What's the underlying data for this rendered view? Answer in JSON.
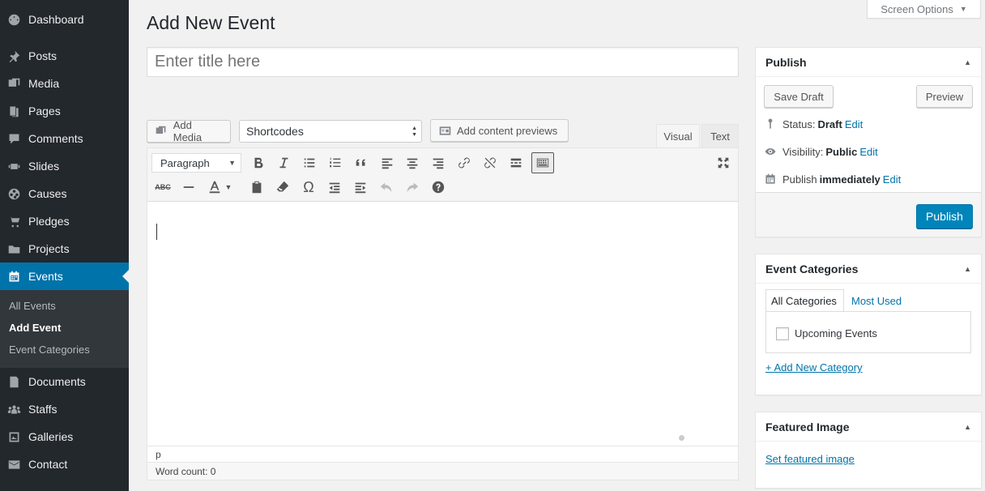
{
  "menu": {
    "items": [
      {
        "label": "Dashboard",
        "icon": "dashboard-icon"
      },
      {
        "label": "Posts",
        "icon": "pin-icon"
      },
      {
        "label": "Media",
        "icon": "media-icon"
      },
      {
        "label": "Pages",
        "icon": "pages-icon"
      },
      {
        "label": "Comments",
        "icon": "comments-icon"
      },
      {
        "label": "Slides",
        "icon": "slides-icon"
      },
      {
        "label": "Causes",
        "icon": "causes-icon"
      },
      {
        "label": "Pledges",
        "icon": "cart-icon"
      },
      {
        "label": "Projects",
        "icon": "folder-icon"
      },
      {
        "label": "Events",
        "icon": "calendar-icon"
      },
      {
        "label": "Documents",
        "icon": "document-icon"
      },
      {
        "label": "Staffs",
        "icon": "groups-icon"
      },
      {
        "label": "Galleries",
        "icon": "gallery-icon"
      },
      {
        "label": "Contact",
        "icon": "email-icon"
      }
    ],
    "submenu": [
      "All Events",
      "Add Event",
      "Event Categories"
    ]
  },
  "screen_options": "Screen Options",
  "page_title": "Add New Event",
  "title_placeholder": "Enter title here",
  "media_buttons": {
    "add_media": "Add Media",
    "shortcodes": "Shortcodes",
    "content_previews": "Add content previews"
  },
  "editor_tabs": {
    "visual": "Visual",
    "text": "Text"
  },
  "toolbar": {
    "format": "Paragraph",
    "row1_icons": [
      "bold-icon",
      "italic-icon",
      "bulleted-list-icon",
      "numbered-list-icon",
      "blockquote-icon",
      "align-left-icon",
      "align-center-icon",
      "align-right-icon",
      "link-icon",
      "unlink-icon",
      "read-more-icon",
      "toolbar-toggle-icon",
      "fullscreen-icon"
    ],
    "row2_icons": [
      "strikethrough-icon",
      "horizontal-line-icon",
      "text-color-icon",
      "paste-text-icon",
      "clear-formatting-icon",
      "special-character-icon",
      "outdent-icon",
      "indent-icon",
      "undo-icon",
      "redo-icon",
      "help-icon"
    ]
  },
  "editor": {
    "path": "p",
    "word_count": "Word count: 0"
  },
  "publish": {
    "title": "Publish",
    "save_draft": "Save Draft",
    "preview": "Preview",
    "status_label": "Status:",
    "status_value": "Draft",
    "visibility_label": "Visibility:",
    "visibility_value": "Public",
    "publish_label": "Publish",
    "publish_value": "immediately",
    "edit": "Edit",
    "publish_button": "Publish"
  },
  "categories": {
    "title": "Event Categories",
    "tab_all": "All Categories",
    "tab_used": "Most Used",
    "items": [
      "Upcoming Events"
    ],
    "add_new": "+ Add New Category"
  },
  "featured": {
    "title": "Featured Image",
    "set": "Set featured image"
  },
  "colors": {
    "sidebar": "#23282d",
    "accent": "#0073aa",
    "primary_button": "#0085ba"
  }
}
